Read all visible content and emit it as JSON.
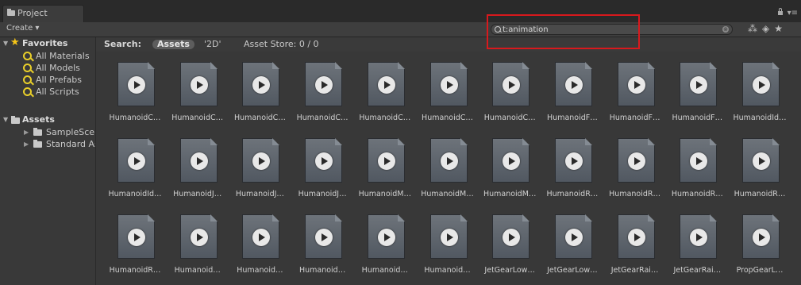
{
  "window": {
    "tab_label": "Project",
    "create_label": "Create ▾"
  },
  "search": {
    "value": "t:animation",
    "clear_glyph": "⊗"
  },
  "sidebar": {
    "favorites_label": "Favorites",
    "favorites": [
      "All Materials",
      "All Models",
      "All Prefabs",
      "All Scripts"
    ],
    "assets_label": "Assets",
    "folders": [
      "SampleScenes",
      "Standard Assets"
    ]
  },
  "searchbar": {
    "label": "Search:",
    "assets": "Assets",
    "filter_2d": "'2D'",
    "store": "Asset Store: 0 / 0"
  },
  "assets": [
    "HumanoidC…",
    "HumanoidC…",
    "HumanoidC…",
    "HumanoidC…",
    "HumanoidC…",
    "HumanoidC…",
    "HumanoidC…",
    "HumanoidF…",
    "HumanoidF…",
    "HumanoidF…",
    "HumanoidId…",
    "HumanoidId…",
    "HumanoidJ…",
    "HumanoidJ…",
    "HumanoidJ…",
    "HumanoidM…",
    "HumanoidM…",
    "HumanoidM…",
    "HumanoidR…",
    "HumanoidR…",
    "HumanoidR…",
    "HumanoidR…",
    "HumanoidR…",
    "Humanoid…",
    "Humanoid…",
    "Humanoid…",
    "Humanoid…",
    "Humanoid…",
    "JetGearLow…",
    "JetGearLow…",
    "JetGearRai…",
    "JetGearRai…",
    "PropGearL…"
  ]
}
